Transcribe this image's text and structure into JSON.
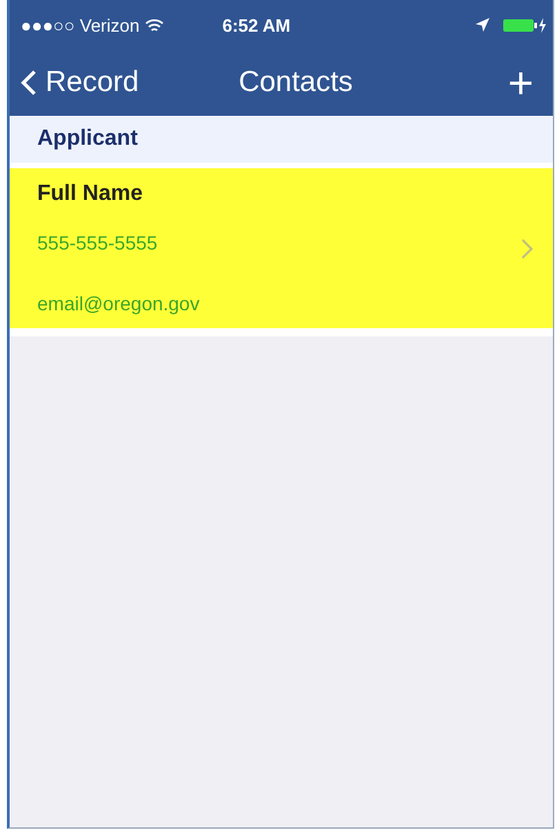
{
  "status_bar": {
    "carrier": "●●●○○ Verizon",
    "time": "6:52 AM"
  },
  "nav_bar": {
    "back": "Record",
    "title": "Contacts",
    "add": "+"
  },
  "section": {
    "title": "Applicant"
  },
  "contacts": [
    {
      "name": "Full Name",
      "phone": "555-555-5555",
      "email": "email@oregon.gov",
      "highlighted": true
    }
  ]
}
